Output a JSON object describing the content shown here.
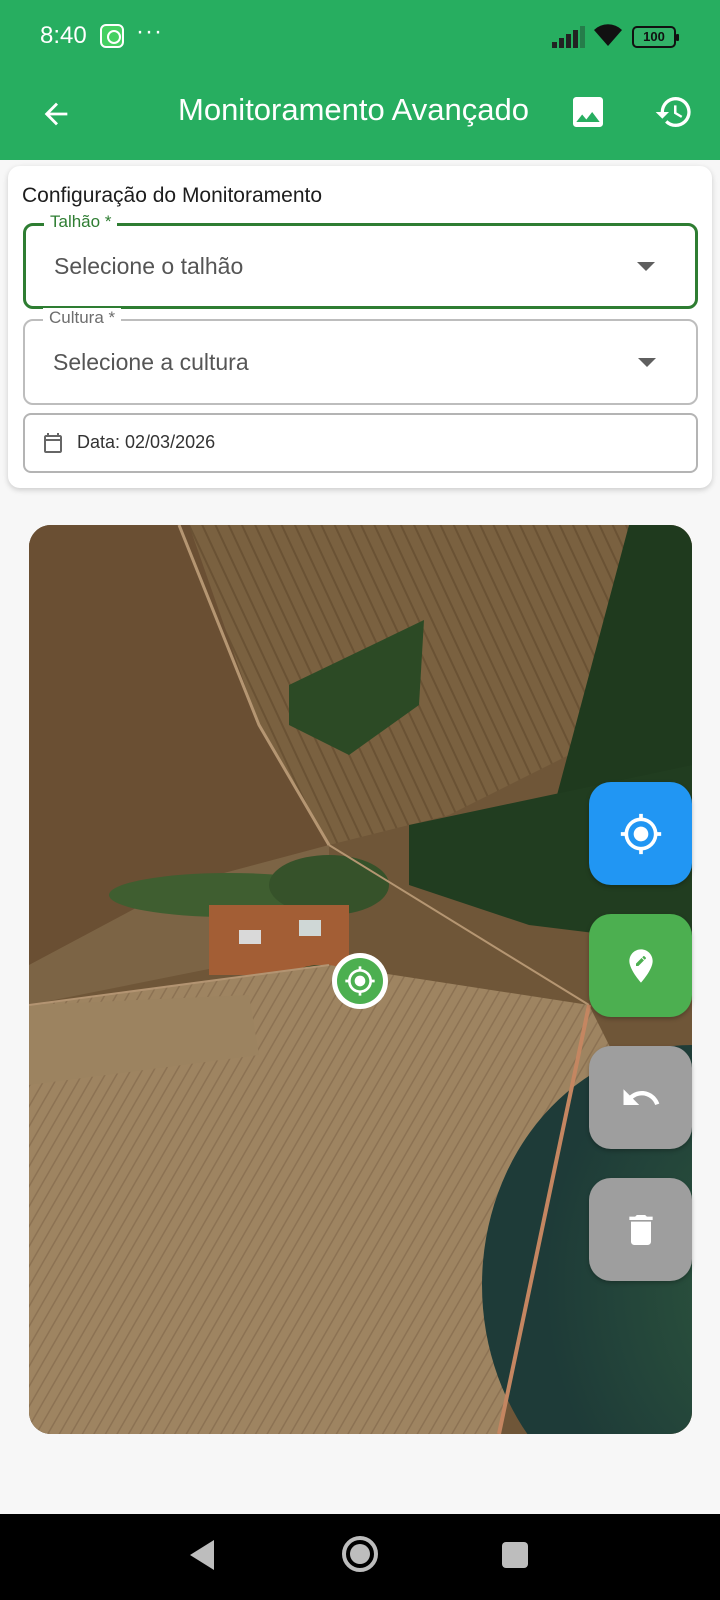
{
  "status_bar": {
    "time": "8:40",
    "notification_icons": [
      "whatsapp-icon"
    ],
    "overflow": "···",
    "battery": "100"
  },
  "app_bar": {
    "title": "Monitoramento Avançado",
    "back_icon": "arrow-back-icon",
    "actions": [
      "image-icon",
      "history-icon"
    ],
    "background_color": "#27ae60"
  },
  "config": {
    "title": "Configuração do Monitoramento",
    "talhao": {
      "label": "Talhão *",
      "placeholder": "Selecione o talhão",
      "focused": true
    },
    "cultura": {
      "label": "Cultura *",
      "placeholder": "Selecione a cultura"
    },
    "date": {
      "text": "Data: 02/03/2026"
    }
  },
  "map": {
    "type": "satellite",
    "current_location_marker": "my-location-icon",
    "buttons": [
      {
        "name": "locate-button",
        "icon": "gps-fixed-icon",
        "color": "#2196f3"
      },
      {
        "name": "draw-point-button",
        "icon": "edit-location-icon",
        "color": "#4caf50"
      },
      {
        "name": "undo-button",
        "icon": "undo-icon",
        "color": "#9e9e9e"
      },
      {
        "name": "delete-button",
        "icon": "delete-icon",
        "color": "#9e9e9e"
      }
    ]
  },
  "nav_bar": {
    "buttons": [
      "nav-back-icon",
      "nav-home-icon",
      "nav-recents-icon"
    ]
  }
}
